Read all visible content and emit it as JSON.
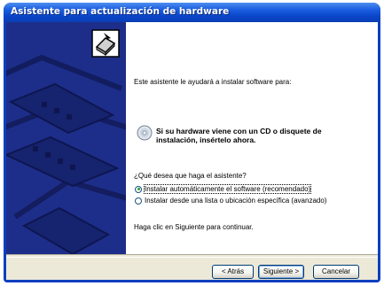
{
  "window": {
    "title": "Asistente para actualización de hardware"
  },
  "content": {
    "intro": "Este asistente le ayudará a instalar software para:",
    "cd_message_line1": "Si su hardware viene con un CD o disquete de",
    "cd_message_line2": "instalación, insértelo ahora.",
    "question": "¿Qué desea que haga el asistente?",
    "options": [
      {
        "label": "Instalar automáticamente el software (recomendado)",
        "selected": true
      },
      {
        "label": "Instalar desde una lista o ubicación específica (avanzado)",
        "selected": false
      }
    ],
    "continue_hint": "Haga clic en Siguiente para continuar."
  },
  "buttons": {
    "back": "< Atrás",
    "next": "Siguiente >",
    "cancel": "Cancelar"
  },
  "icons": {
    "wizard": "hardware-wizard-icon",
    "cd": "cd-icon"
  }
}
